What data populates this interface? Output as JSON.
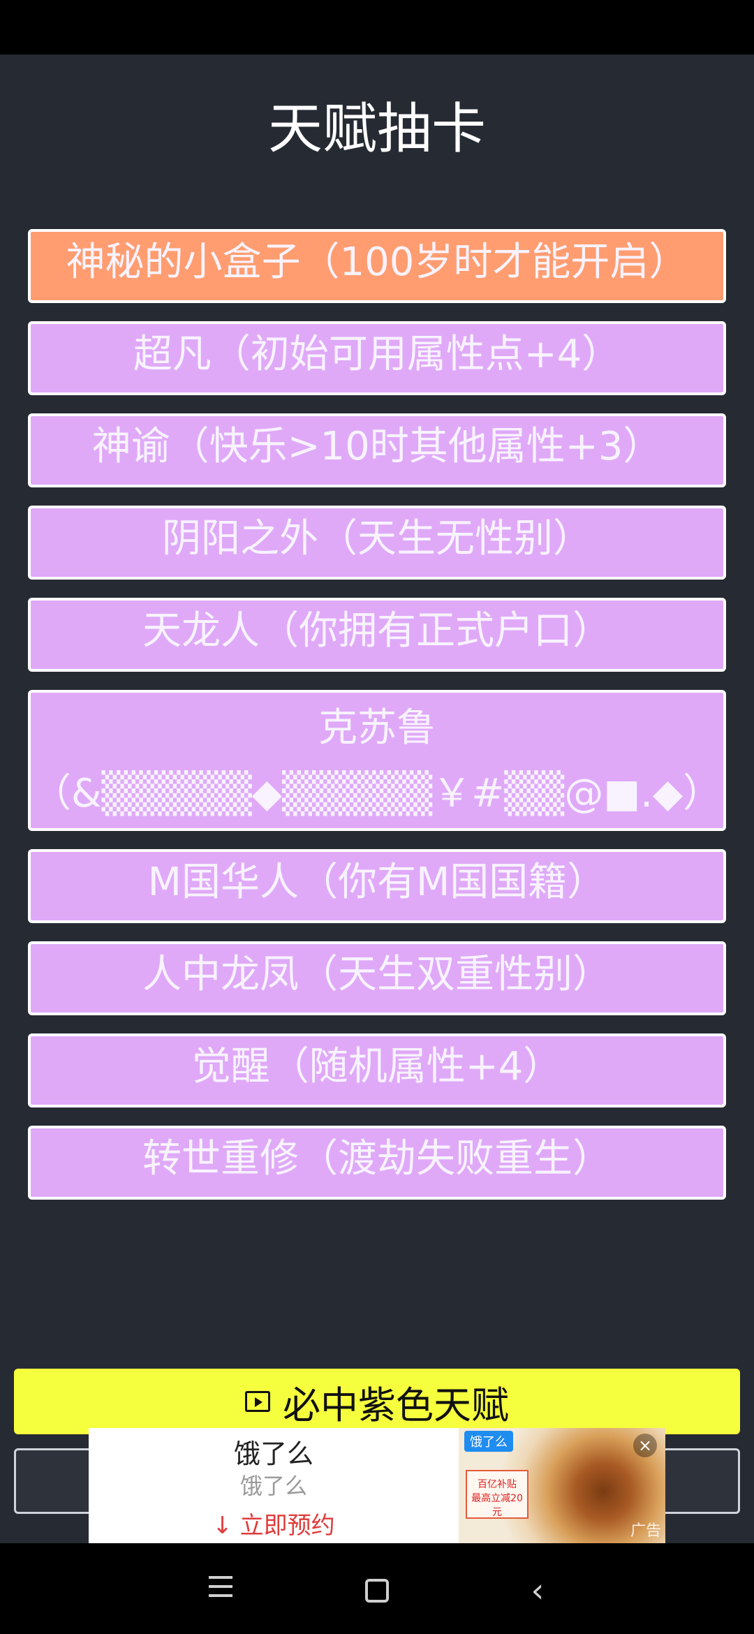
{
  "page": {
    "title": "天赋抽卡"
  },
  "colors": {
    "background": "#262a33",
    "card_purple": "#dfa9f8",
    "card_orange": "#ff9d70",
    "primary_button": "#f6ff3d"
  },
  "talents": [
    {
      "label": "神秘的小盒子（100岁时才能开启）",
      "color": "orange"
    },
    {
      "label": "超凡（初始可用属性点+4）",
      "color": "purple"
    },
    {
      "label": "神谕（快乐>10时其他属性+3）",
      "color": "purple"
    },
    {
      "label": "阴阳之外（天生无性别）",
      "color": "purple"
    },
    {
      "label": "天龙人（你拥有正式户口）",
      "color": "purple"
    },
    {
      "label_line1": "克苏鲁",
      "label_line2": "（&▒▒▒▒▒◆▒▒▒▒▒￥#▒▒@■.◆）",
      "color": "purple"
    },
    {
      "label": "M国华人（你有M国国籍）",
      "color": "purple"
    },
    {
      "label": "人中龙凤（天生双重性别）",
      "color": "purple"
    },
    {
      "label": "觉醒（随机属性+4）",
      "color": "purple"
    },
    {
      "label": "转世重修（渡劫失败重生）",
      "color": "purple"
    }
  ],
  "actions": {
    "primary_label": "必中紫色天赋",
    "primary_icon": "film-icon"
  },
  "ad": {
    "title": "饿了么",
    "subtitle": "饿了么",
    "cta": "立即预约",
    "brand": "饿了么",
    "coupon_line1": "百亿补贴",
    "coupon_line2": "最高立减20元",
    "tag": "广告",
    "close_icon": "close-icon"
  },
  "nav": {
    "menu_icon": "menu-icon",
    "home_icon": "home-icon",
    "back_icon": "back-icon"
  }
}
